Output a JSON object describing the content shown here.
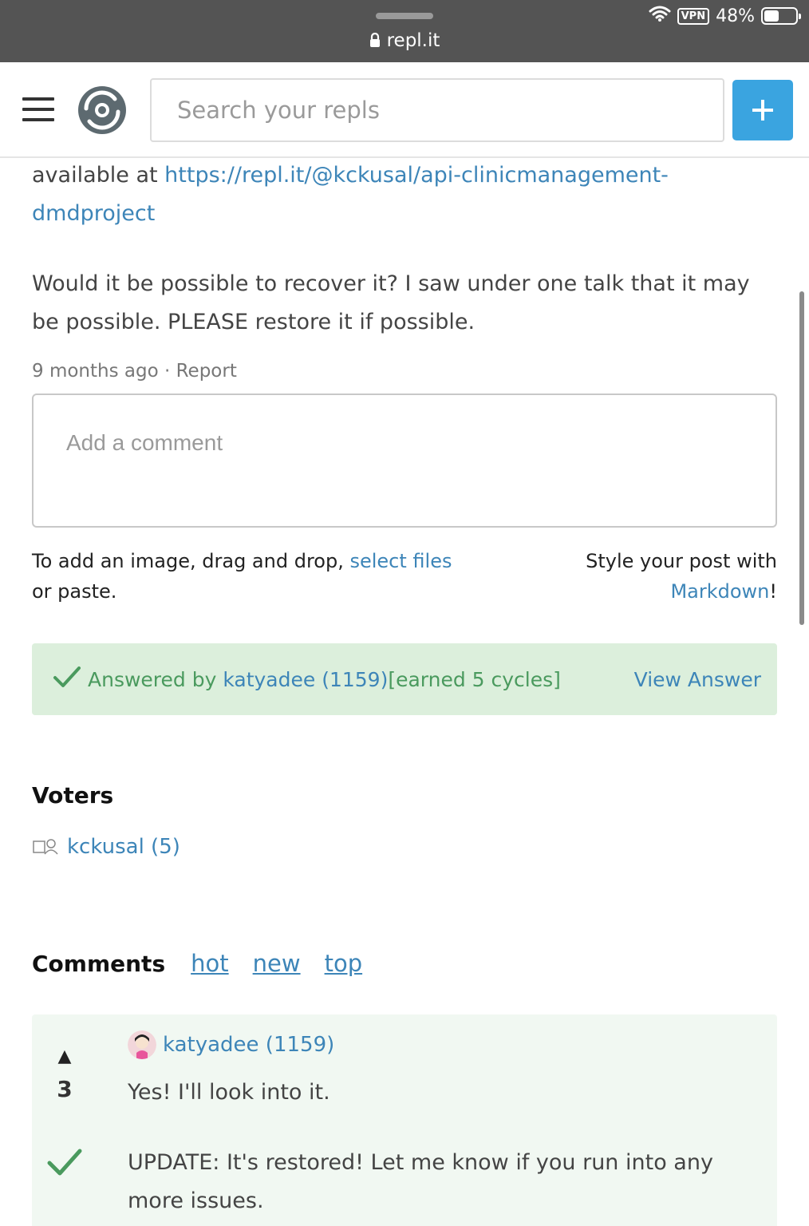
{
  "browser": {
    "url": "repl.it",
    "battery": "48%",
    "battery_level": 0.48,
    "vpn_label": "VPN"
  },
  "header": {
    "search_placeholder": "Search your repls",
    "accent_color": "#3aa4e0"
  },
  "post": {
    "intro_text": "available at ",
    "repl_link": "https://repl.it/@kckusal/api-clinicmanagement-dmdproject",
    "body": "Would it be possible to recover it? I saw under one talk that it may be possible. PLEASE restore it if possible.",
    "time_ago": "9 months ago",
    "separator": "·",
    "report_label": "Report"
  },
  "comment_form": {
    "placeholder": "Add a comment",
    "image_hint_prefix": "To add an image, drag and drop, ",
    "select_files_label": "select files",
    "image_hint_suffix": "or paste.",
    "style_hint": "Style your post with",
    "markdown_label": "Markdown",
    "markdown_suffix": "!"
  },
  "answer_banner": {
    "prefix": "Answered by ",
    "author": "katyadee (1159)",
    "earned": " [earned 5 cycles]",
    "view_label": "View Answer",
    "bg_color": "#dcefdc",
    "text_color": "#4a9a5e"
  },
  "voters": {
    "heading": "Voters",
    "items": [
      {
        "name": "kckusal (5)"
      }
    ]
  },
  "comments": {
    "heading": "Comments",
    "sort_options": [
      "hot",
      "new",
      "top"
    ],
    "items": [
      {
        "author": "katyadee (1159)",
        "votes": "3",
        "paragraphs": [
          "Yes! I'll look into it.",
          "UPDATE: It's restored! Let me know if you run into any more issues."
        ]
      }
    ]
  }
}
